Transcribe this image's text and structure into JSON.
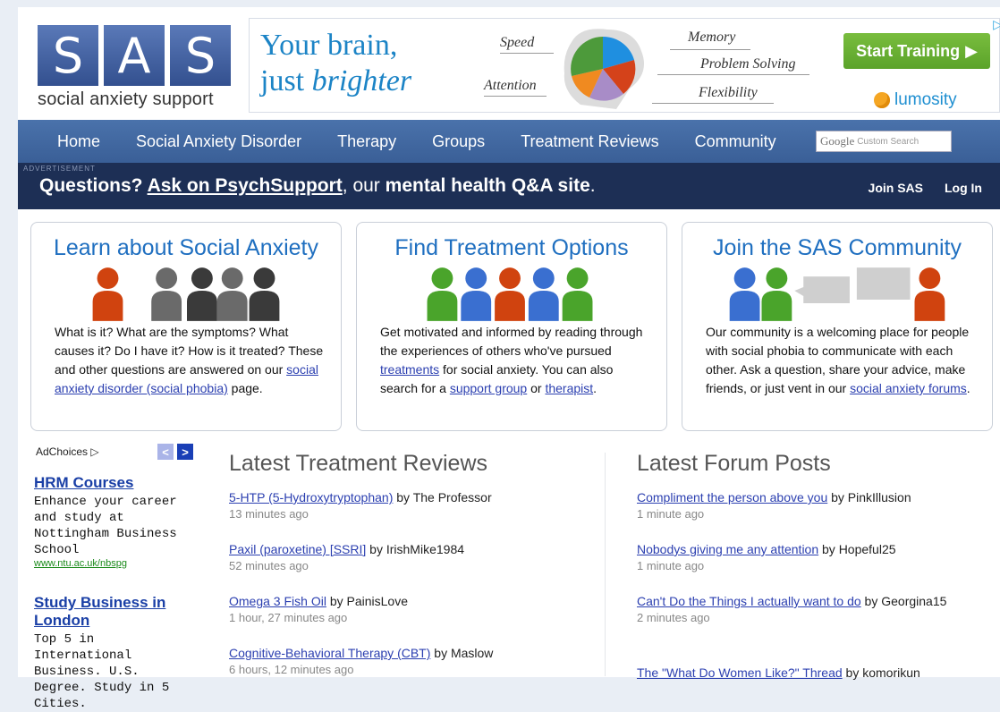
{
  "logo": {
    "letters": [
      "S",
      "A",
      "S"
    ],
    "tagline": "social anxiety support"
  },
  "banner": {
    "headline_1": "Your brain,",
    "headline_2a": "just ",
    "headline_2b": "brighter",
    "labels": [
      "Speed",
      "Attention",
      "Memory",
      "Problem Solving",
      "Flexibility"
    ],
    "cta": "Start Training",
    "brand": "lumosity"
  },
  "nav": {
    "items": [
      "Home",
      "Social Anxiety Disorder",
      "Therapy",
      "Groups",
      "Treatment Reviews",
      "Community"
    ],
    "search_placeholder": "Custom Search",
    "search_brand": "Google"
  },
  "qbar": {
    "ad_label": "ADVERTISEMENT",
    "q1": "Questions? ",
    "link": "Ask on PsychSupport",
    "q2": ", our ",
    "q3": "mental health Q&A site",
    "q4": ".",
    "join": "Join SAS",
    "login": "Log In"
  },
  "features": [
    {
      "title": "Learn about Social Anxiety",
      "text_1": "What is it? What are the symptoms? What causes it? Do I have it? How is it treated? These and other questions are answered on our ",
      "link_1": "social anxiety disorder (social phobia)",
      "text_2": " page."
    },
    {
      "title": "Find Treatment Options",
      "text_1": "Get motivated and informed by reading through the experiences of others who've pursued ",
      "link_1": "treatments",
      "text_2": " for social anxiety. You can also search for a ",
      "link_2": "support group",
      "text_3": " or ",
      "link_3": "therapist",
      "text_4": "."
    },
    {
      "title": "Join the SAS Community",
      "text_1": "Our community is a welcoming place for people with social phobia to communicate with each other. Ask a question, share your advice, make friends, or just vent in our ",
      "link_1": "social anxiety forums",
      "text_2": "."
    }
  ],
  "ads": {
    "adchoices": "AdChoices",
    "prev": "<",
    "next": ">",
    "items": [
      {
        "title": "HRM Courses",
        "desc": "Enhance your career and study at Nottingham Business School",
        "url": "www.ntu.ac.uk/nbspg"
      },
      {
        "title": "Study Business in London",
        "desc": "Top 5 in International Business. U.S. Degree. Study in 5 Cities."
      }
    ]
  },
  "reviews": {
    "heading": "Latest Treatment Reviews",
    "items": [
      {
        "title": "5-HTP (5-Hydroxytryptophan)",
        "by": " by The Professor",
        "time": "13 minutes ago"
      },
      {
        "title": "Paxil (paroxetine) [SSRI]",
        "by": " by IrishMike1984",
        "time": "52 minutes ago"
      },
      {
        "title": "Omega 3 Fish Oil",
        "by": " by PainisLove",
        "time": "1 hour, 27 minutes ago"
      },
      {
        "title": "Cognitive-Behavioral Therapy (CBT)",
        "by": " by Maslow",
        "time": "6 hours, 12 minutes ago"
      }
    ]
  },
  "forum": {
    "heading": "Latest Forum Posts",
    "items": [
      {
        "title": "Compliment the person above you",
        "by": " by PinkIllusion",
        "time": "1 minute ago"
      },
      {
        "title": "Nobodys giving me any attention",
        "by": " by Hopeful25",
        "time": "1 minute ago"
      },
      {
        "title": "Can't Do the Things I actually want to do",
        "by": " by Georgina15",
        "time": "2 minutes ago"
      },
      {
        "title": "The \"What Do Women Like?\" Thread",
        "by": " by komorikun",
        "time": ""
      }
    ]
  },
  "colors": {
    "nav": "#4a72ab",
    "qbar": "#1d2f55",
    "link": "#2b3fb0",
    "title": "#1f6fc0",
    "red": "#d0430f",
    "gray": "#6a6a6a",
    "dark": "#3a3a3a",
    "green": "#4aa42b",
    "blue": "#3a6fd0"
  }
}
